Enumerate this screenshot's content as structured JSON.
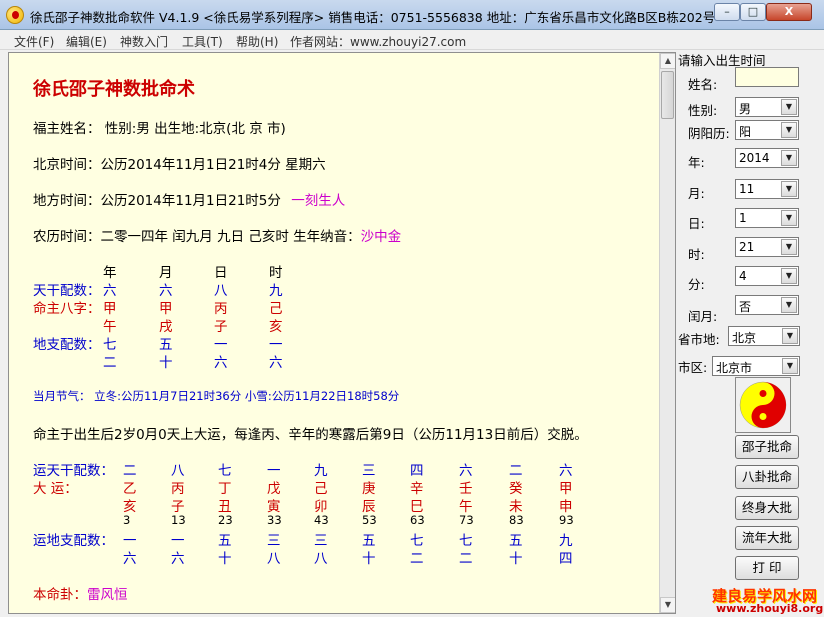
{
  "window": {
    "title": "徐氏邵子神数批命软件 V4.1.9 <徐氏易学系列程序>   销售电话：0751-5556838   地址：广东省乐昌市文化路B区B栋202号",
    "min": "–",
    "max": "□",
    "close": "X"
  },
  "menu": [
    "文件(F)",
    "编辑(E)",
    "神数入门",
    "工具(T)",
    "帮助(H)",
    "作者网站：www.zhouyi27.com"
  ],
  "doc": {
    "title": "徐氏邵子神数批命术",
    "owner": "福主姓名：  性别:男   出生地:北京(北 京 市)",
    "beijing_time": "北京时间：公历2014年11月1日21时4分  星期六",
    "local_time": "地方时间：公历2014年11月1日21时5分",
    "local_time_note": "一刻生人",
    "lunar_time": "农历时间：二零一四年  闰九月  九日  己亥时      生年纳音：",
    "nayin": "沙中金",
    "pillars": {
      "headers": [
        "年",
        "月",
        "日",
        "时"
      ],
      "tiangan_label": "天干配数：",
      "tiangan": [
        "六",
        "六",
        "八",
        "九"
      ],
      "bazi_label": "命主八字：",
      "stems": [
        "甲",
        "甲",
        "丙",
        "己"
      ],
      "branches": [
        "午",
        "戌",
        "子",
        "亥"
      ],
      "dizhi_label": "地支配数：",
      "dizhi1": [
        "七",
        "五",
        "一",
        "一"
      ],
      "dizhi2": [
        "二",
        "十",
        "六",
        "六"
      ]
    },
    "jieqi": "当月节气：  立冬:公历11月7日21时36分  小雪:公历11月22日18时58分",
    "dayun_text": "命主于出生后2岁0月0天上大运，每逢丙、辛年的寒露后第9日（公历11月13日前后）交脱。",
    "yun": {
      "tiangan_label": "运天干配数：",
      "tiangan": [
        "二",
        "八",
        "七",
        "一",
        "九",
        "三",
        "四",
        "六",
        "二",
        "六"
      ],
      "dayun_label": "大    运：",
      "stems": [
        "乙",
        "丙",
        "丁",
        "戊",
        "己",
        "庚",
        "辛",
        "壬",
        "癸",
        "甲"
      ],
      "branches": [
        "亥",
        "子",
        "丑",
        "寅",
        "卯",
        "辰",
        "巳",
        "午",
        "未",
        "申"
      ],
      "ages": [
        "3",
        "13",
        "23",
        "33",
        "43",
        "53",
        "63",
        "73",
        "83",
        "93"
      ],
      "dizhi_label": "运地支配数：",
      "dizhi1": [
        "一",
        "一",
        "五",
        "三",
        "三",
        "五",
        "七",
        "七",
        "五",
        "九"
      ],
      "dizhi2": [
        "六",
        "六",
        "十",
        "八",
        "八",
        "十",
        "二",
        "二",
        "十",
        "四"
      ]
    },
    "benming_label": "本命卦：",
    "benming_value": "雷风恒"
  },
  "panel": {
    "prompt": "请输入出生时间",
    "name_label": "姓名:",
    "name_value": "",
    "gender_label": "性别:",
    "gender_value": "男",
    "calendar_label": "阴阳历:",
    "calendar_value": "阳",
    "year_label": "年:",
    "year_value": "2014",
    "month_label": "月:",
    "month_value": "11",
    "day_label": "日:",
    "day_value": "1",
    "hour_label": "时:",
    "hour_value": "21",
    "minute_label": "分:",
    "minute_value": "4",
    "leap_label": "闰月:",
    "leap_value": "否",
    "province_label": "省市地:",
    "province_value": "北京",
    "district_label": "市区:",
    "district_value": "北京市",
    "buttons": [
      "邵子批命",
      "八卦批命",
      "终身大批",
      "流年大批",
      "打 印"
    ]
  },
  "watermark": {
    "line1": "建良易学风水网",
    "line2": "www.zhouyi8.org"
  },
  "colors": {
    "doc_background": "#ffffe1",
    "title_red": "#cc0000",
    "label_blue": "#0000cc",
    "accent_purple": "#cc00cc"
  }
}
